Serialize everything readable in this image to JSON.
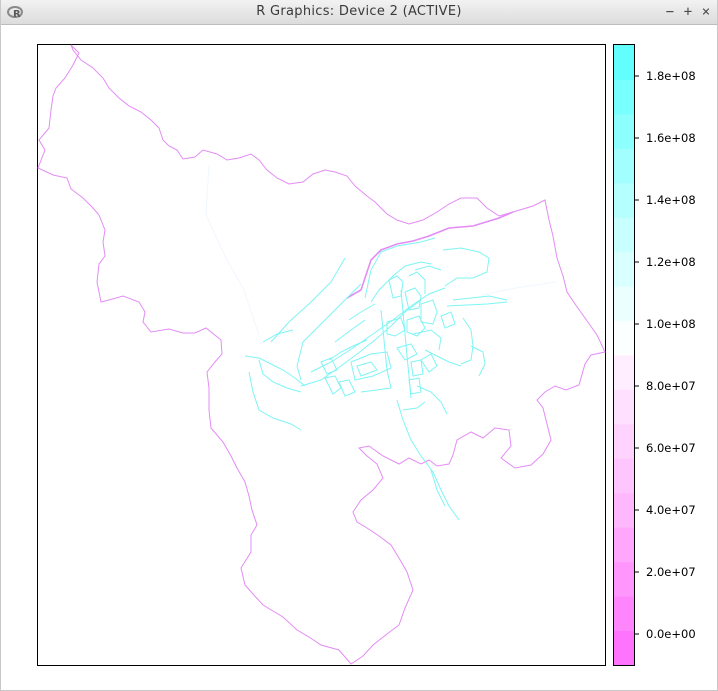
{
  "window": {
    "title": "R Graphics: Device 2 (ACTIVE)",
    "controls": {
      "minimize": "−",
      "maximize": "+",
      "close": "×"
    },
    "app_icon": "r-logo-icon"
  },
  "plot": {
    "boundary_color": "#e38cf5",
    "network_color": "#7ff4f4",
    "frame_color": "#000000"
  },
  "colorkey": {
    "colors": [
      "#ff73fd",
      "#ff85fd",
      "#ff96fd",
      "#ffa7fe",
      "#ffb7fe",
      "#ffc5fe",
      "#ffd3fe",
      "#ffe0fe",
      "#ffeeff",
      "#fcffff",
      "#ebffff",
      "#daffff",
      "#c8ffff",
      "#b5ffff",
      "#a2ffff",
      "#8dffff",
      "#78ffff",
      "#63ffff"
    ],
    "ticks": [
      {
        "label": "0.0e+00",
        "value": 0
      },
      {
        "label": "2.0e+07",
        "value": 20000000
      },
      {
        "label": "4.0e+07",
        "value": 40000000
      },
      {
        "label": "6.0e+07",
        "value": 60000000
      },
      {
        "label": "8.0e+07",
        "value": 80000000
      },
      {
        "label": "1.0e+08",
        "value": 100000000
      },
      {
        "label": "1.2e+08",
        "value": 120000000
      },
      {
        "label": "1.4e+08",
        "value": 140000000
      },
      {
        "label": "1.6e+08",
        "value": 160000000
      },
      {
        "label": "1.8e+08",
        "value": 180000000
      }
    ],
    "range": [
      -10000000,
      190000000
    ]
  }
}
